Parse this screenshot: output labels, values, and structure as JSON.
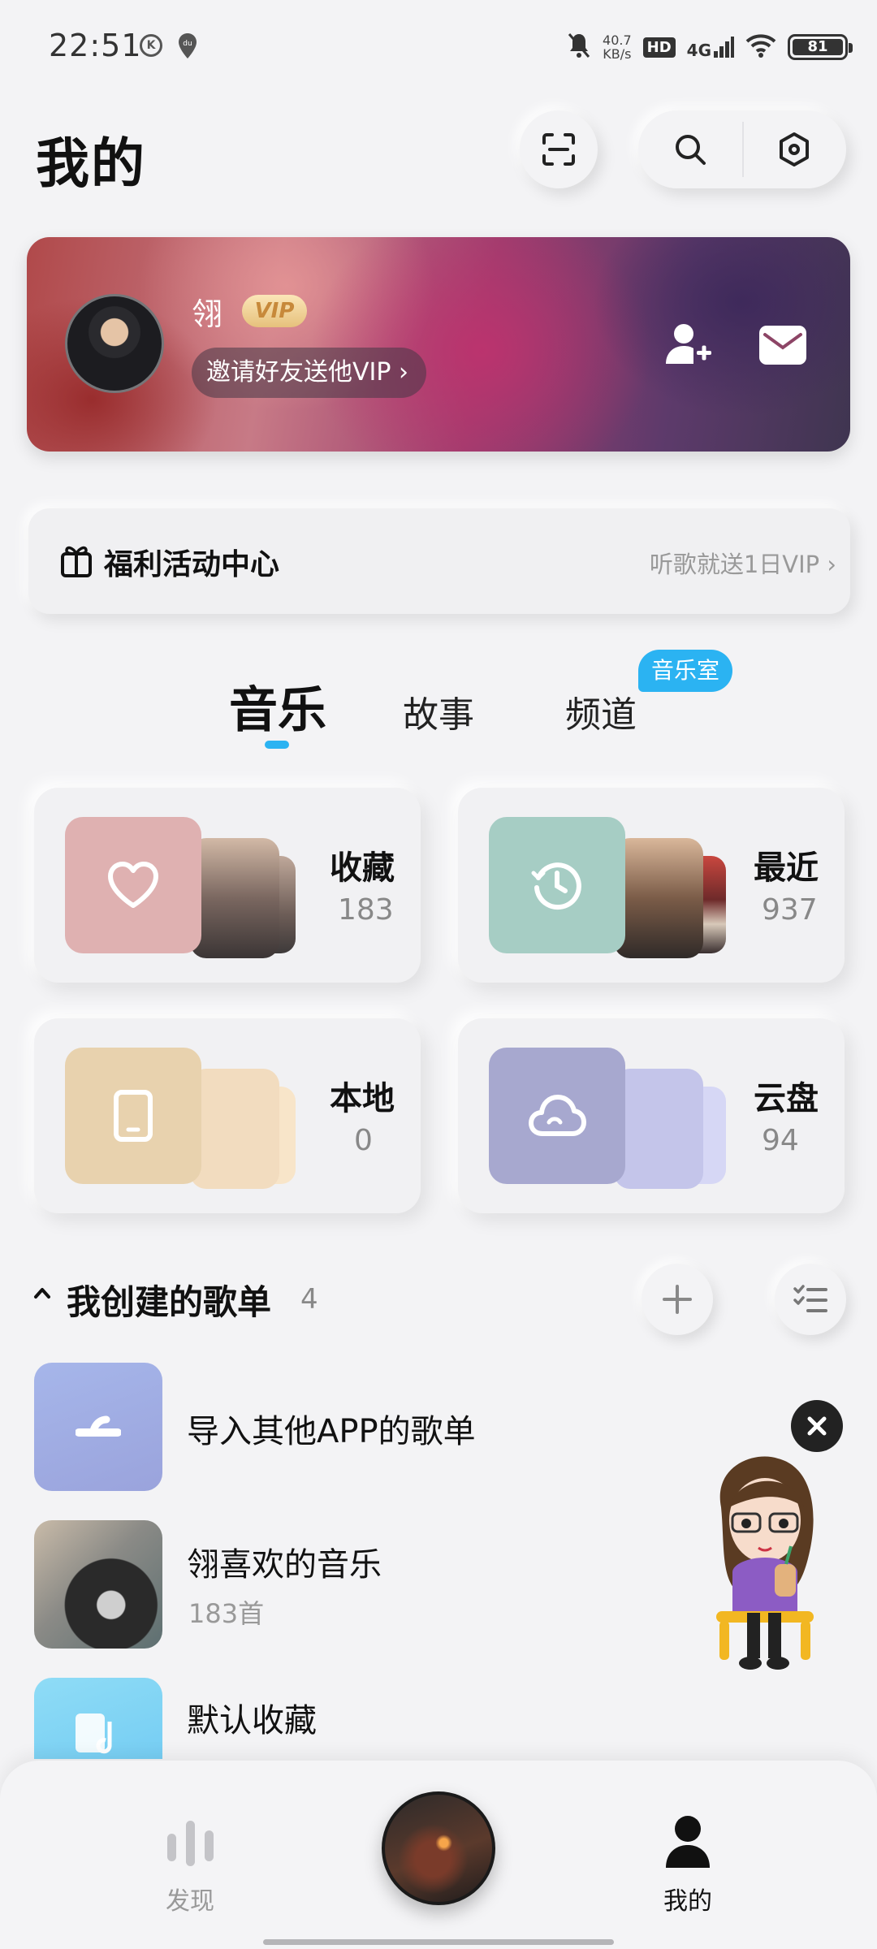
{
  "status_bar": {
    "time": "22:51",
    "icon_k": "K",
    "icon_du": "du",
    "speed_value": "40.7",
    "speed_unit": "KB/s",
    "hd": "HD",
    "network": "4G",
    "battery": "81"
  },
  "header": {
    "title": "我的"
  },
  "profile": {
    "name": "翎",
    "vip": "VIP",
    "invite": "邀请好友送他VIP ›"
  },
  "welfare": {
    "title": "福利活动中心",
    "subtitle": "听歌就送1日VIP ›"
  },
  "tabs": [
    {
      "label": "音乐",
      "active": true
    },
    {
      "label": "故事",
      "active": false
    },
    {
      "label": "频道",
      "active": false
    }
  ],
  "tab_badge": "音乐室",
  "music_cards": [
    {
      "title": "收藏",
      "count": "183",
      "icon": "heart-icon",
      "color": "#dfb1b1"
    },
    {
      "title": "最近",
      "count": "937",
      "icon": "clock-icon",
      "color": "#a6cdc4"
    },
    {
      "title": "本地",
      "count": "0",
      "icon": "phone-icon",
      "color": "#e8d2ae"
    },
    {
      "title": "云盘",
      "count": "94",
      "icon": "cloud-icon",
      "color": "#a7a8cf"
    }
  ],
  "playlists_section": {
    "title": "我创建的歌单",
    "count": "4"
  },
  "playlists": [
    {
      "title": "导入其他APP的歌单",
      "subtitle": ""
    },
    {
      "title": "翎喜欢的音乐",
      "subtitle": "183首"
    },
    {
      "title": "默认收藏",
      "subtitle": ""
    }
  ],
  "bottom_nav": {
    "discover": "发现",
    "mine": "我的"
  },
  "colors": {
    "accent": "#2bb3f2",
    "background": "#f3f3f5"
  }
}
